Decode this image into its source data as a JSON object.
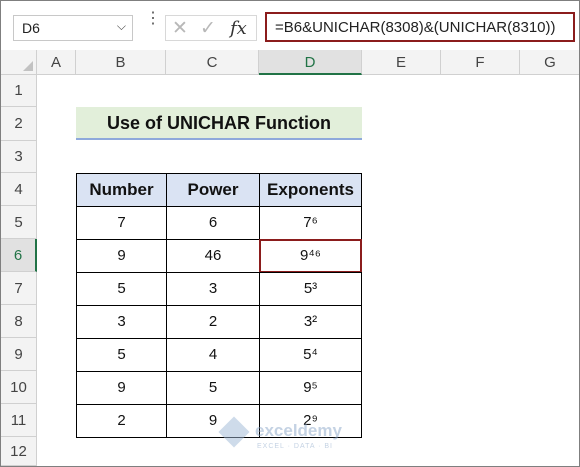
{
  "formula_bar": {
    "name_box": "D6",
    "name_box_caret": "⌵",
    "dots": "⋮",
    "cancel_glyph": "✕",
    "enter_glyph": "✓",
    "fx_glyph": "fx",
    "formula": "=B6&UNICHAR(8308)&(UNICHAR(8310))"
  },
  "columns": [
    "A",
    "B",
    "C",
    "D",
    "E",
    "F",
    "G"
  ],
  "rows": [
    "1",
    "2",
    "3",
    "4",
    "5",
    "6",
    "7",
    "8",
    "9",
    "10",
    "11",
    "12"
  ],
  "selected": {
    "column": "D",
    "row": "6"
  },
  "title": "Use of UNICHAR Function",
  "table": {
    "headers": [
      "Number",
      "Power",
      "Exponents"
    ],
    "rows": [
      [
        "7",
        "6",
        "7⁶"
      ],
      [
        "9",
        "46",
        "9⁴⁶"
      ],
      [
        "5",
        "3",
        "5³"
      ],
      [
        "3",
        "2",
        "3²"
      ],
      [
        "5",
        "4",
        "5⁴"
      ],
      [
        "9",
        "5",
        "9⁵"
      ],
      [
        "2",
        "9",
        "2⁹"
      ]
    ]
  },
  "watermark": {
    "name": "exceldemy",
    "tagline": "EXCEL · DATA · BI"
  },
  "colors": {
    "selection_green": "#217346",
    "active_border": "#8b1c1c",
    "title_fill": "#e2efda",
    "header_fill": "#dae3f3"
  }
}
